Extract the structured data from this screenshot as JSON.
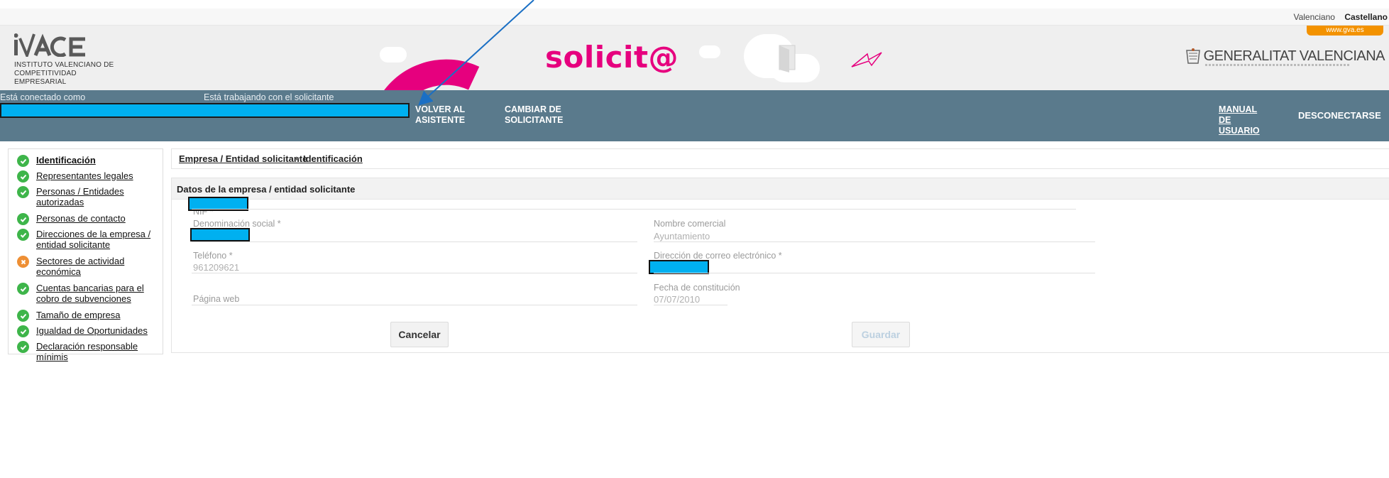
{
  "language_bar": {
    "options": [
      "Valenciano",
      "Castellano"
    ],
    "active": "Castellano"
  },
  "header": {
    "org_logo": "IVACE",
    "org_name_line1": "INSTITUTO VALENCIANO DE",
    "org_name_line2": "COMPETITIVIDAD EMPRESARIAL",
    "app_name": "solicit@",
    "gva_link": "www.gva.es",
    "gva_name": "GENERALITAT VALENCIANA",
    "app_color": "#e6007e",
    "gva_tab_color": "#f39200"
  },
  "navbar": {
    "connected_as_label": "Está conectado como",
    "working_with_label": "Está trabajando con el solicitante",
    "back_to_wizard": "VOLVER AL ASISTENTE",
    "change_applicant": "CAMBIAR DE SOLICITANTE",
    "user_manual": "MANUAL DE USUARIO",
    "logout": "DESCONECTARSE",
    "bg_color": "#5a7a8c"
  },
  "sidebar": {
    "items": [
      {
        "label": "Identificación",
        "status": "ok",
        "icon": "check-circle-icon",
        "current": true
      },
      {
        "label": "Representantes legales",
        "status": "ok",
        "icon": "check-circle-icon"
      },
      {
        "label": "Personas / Entidades autorizadas",
        "status": "ok",
        "icon": "check-circle-icon"
      },
      {
        "label": "Personas de contacto",
        "status": "ok",
        "icon": "check-circle-icon"
      },
      {
        "label": "Direcciones de la empresa / entidad solicitante",
        "status": "ok",
        "icon": "check-circle-icon"
      },
      {
        "label": "Sectores de actividad económica",
        "status": "incomplete",
        "icon": "cross-circle-icon"
      },
      {
        "label": "Cuentas bancarias para el cobro de subvenciones",
        "status": "ok",
        "icon": "check-circle-icon"
      },
      {
        "label": "Tamaño de empresa",
        "status": "ok",
        "icon": "check-circle-icon"
      },
      {
        "label": "Igualdad de Oportunidades",
        "status": "ok",
        "icon": "check-circle-icon"
      },
      {
        "label": "Declaración responsable mínimis",
        "status": "ok",
        "icon": "check-circle-icon"
      }
    ],
    "ok_color": "#3eb54a",
    "warn_color": "#ee8f34"
  },
  "breadcrumb": {
    "items": [
      "Empresa / Entidad solicitante",
      "Identificación"
    ]
  },
  "form": {
    "section_title": "Datos de la empresa / entidad solicitante",
    "nif_label": "NIF *",
    "denominacion_label": "Denominación social *",
    "nombre_comercial_label": "Nombre comercial",
    "nombre_comercial_value": "Ayuntamiento",
    "telefono_label": "Teléfono *",
    "telefono_value": "961209621",
    "email_label": "Dirección de correo electrónico *",
    "web_label": "Página web",
    "fecha_label": "Fecha de constitución",
    "fecha_value": "07/07/2010",
    "cancel_button": "Cancelar",
    "save_button": "Guardar",
    "redaction_color": "#00b0f0"
  }
}
